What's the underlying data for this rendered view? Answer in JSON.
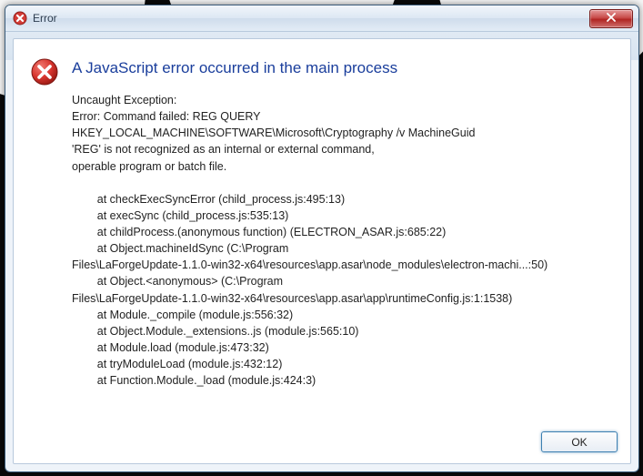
{
  "window": {
    "title": "Error"
  },
  "dialog": {
    "heading": "A JavaScript error occurred in the main process",
    "body": "Uncaught Exception:\nError: Command failed: REG QUERY\nHKEY_LOCAL_MACHINE\\SOFTWARE\\Microsoft\\Cryptography /v MachineGuid\n'REG' is not recognized as an internal or external command,\noperable program or batch file.\n\n        at checkExecSyncError (child_process.js:495:13)\n        at execSync (child_process.js:535:13)\n        at childProcess.(anonymous function) (ELECTRON_ASAR.js:685:22)\n        at Object.machineIdSync (C:\\Program\nFiles\\LaForgeUpdate-1.1.0-win32-x64\\resources\\app.asar\\node_modules\\electron-machi...:50)\n        at Object.<anonymous> (C:\\Program\nFiles\\LaForgeUpdate-1.1.0-win32-x64\\resources\\app.asar\\app\\runtimeConfig.js:1:1538)\n        at Module._compile (module.js:556:32)\n        at Object.Module._extensions..js (module.js:565:10)\n        at Module.load (module.js:473:32)\n        at tryModuleLoad (module.js:432:12)\n        at Function.Module._load (module.js:424:3)",
    "ok_label": "OK"
  }
}
